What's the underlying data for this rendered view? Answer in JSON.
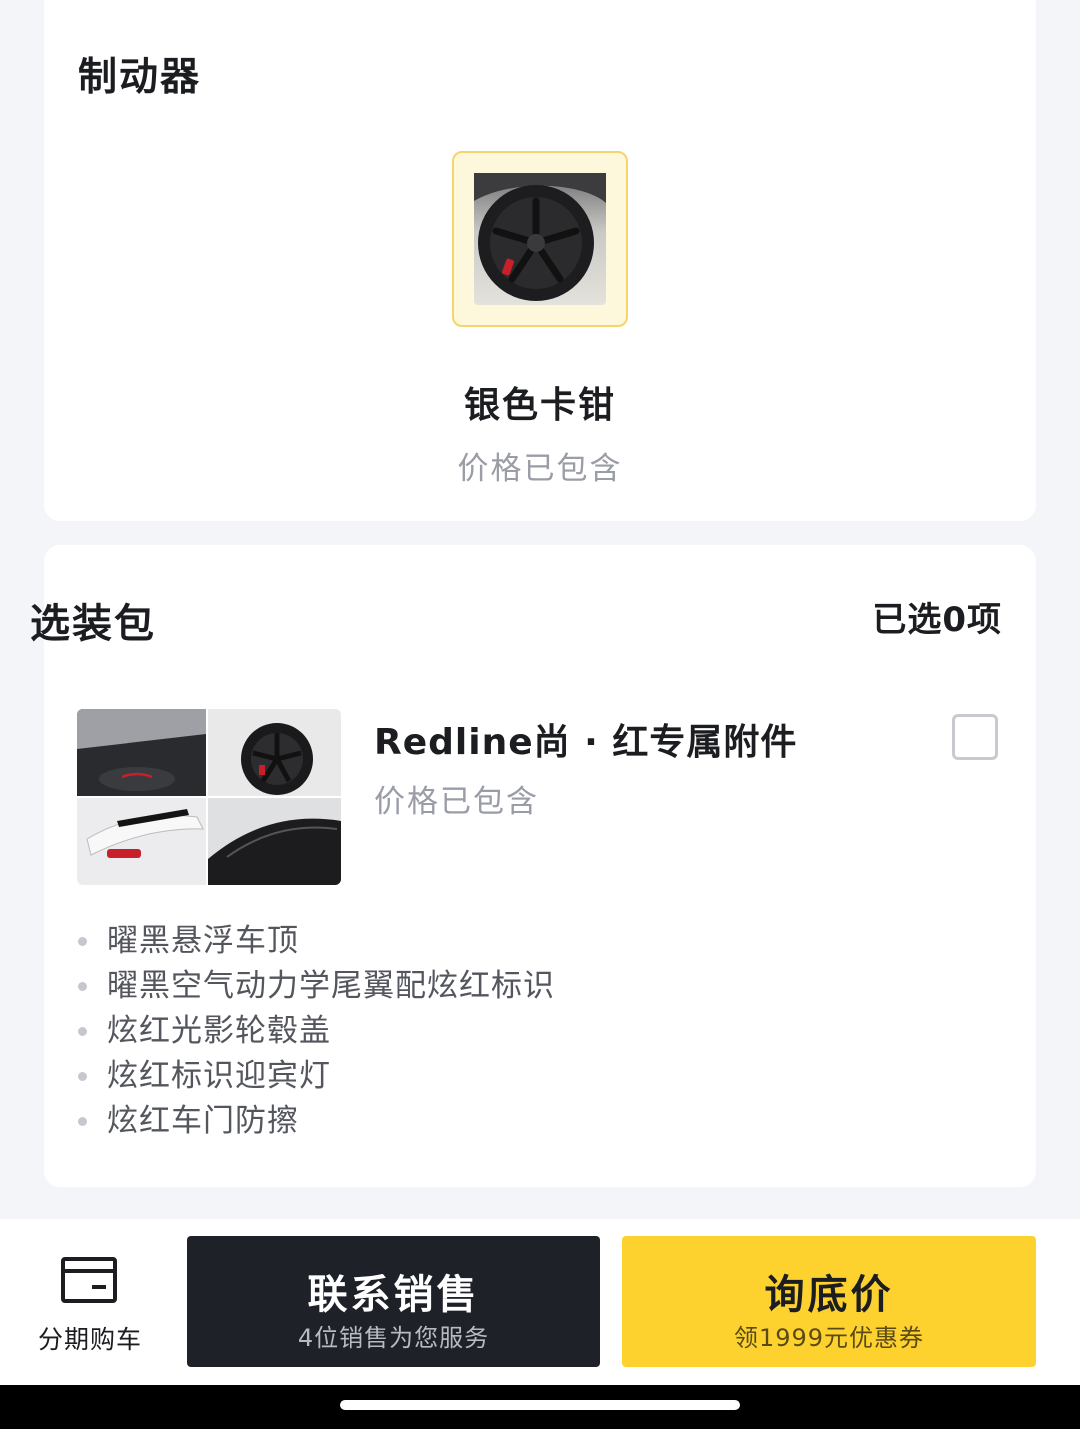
{
  "brake": {
    "title": "制动器",
    "option_name": "银色卡钳",
    "option_price": "价格已包含"
  },
  "package": {
    "title": "选装包",
    "selected_count": "已选0项",
    "item": {
      "name": "Redline尚 · 红专属附件",
      "price": "价格已包含",
      "checked": false,
      "features": [
        "曜黑悬浮车顶",
        "曜黑空气动力学尾翼配炫红标识",
        "炫红光影轮毂盖",
        "炫红标识迎宾灯",
        "炫红车门防擦"
      ]
    }
  },
  "bottom_bar": {
    "installment_label": "分期购车",
    "installment_icon": "card-icon",
    "contact_button": {
      "label": "联系销售",
      "sub": "4位销售为您服务"
    },
    "price_button": {
      "label": "询底价",
      "sub": "领1999元优惠券"
    }
  },
  "colors": {
    "accent_yellow": "#fdd22f",
    "dark_button": "#1f2129",
    "muted_text": "#9a9ca6"
  }
}
